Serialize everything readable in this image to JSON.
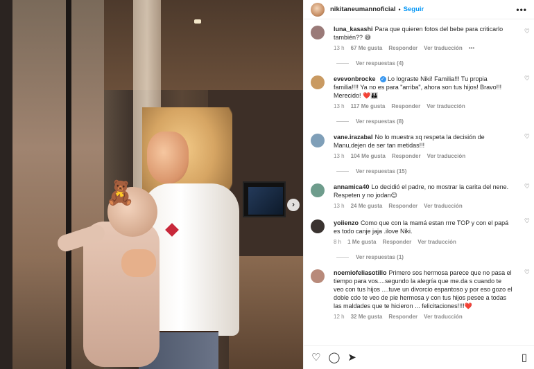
{
  "post": {
    "username": "nikitaneumannoficial",
    "separator": "•",
    "follow_label": "Seguir",
    "more_label": "•••"
  },
  "photo": {
    "sticker": "🧸",
    "next_label": "›"
  },
  "comments": [
    {
      "username": "luna_kasashi",
      "text": "Para que quieren fotos del bebe para criticarlo también?? 😅",
      "time": "13 h",
      "likes": "67 Me gusta",
      "reply": "Responder",
      "translate": "Ver traducción",
      "more": "•••",
      "replies": "Ver respuestas (4)",
      "avatar_color": "#9a7a78"
    },
    {
      "username": "evevonbrocke",
      "verified": "✓",
      "text": "Lo lograste Niki! Familia!!! Tu propia familia!!!! Ya no es para \"arriba\", ahora son tus hijos! Bravo!!! Merecido! ❤️👪",
      "time": "13 h",
      "likes": "117 Me gusta",
      "reply": "Responder",
      "translate": "Ver traducción",
      "replies": "Ver respuestas (8)",
      "avatar_color": "#c99a62"
    },
    {
      "username": "vane.irazabal",
      "text": "No lo muestra xq respeta la decisión de Manu,dejen de ser tan metidas!!!",
      "time": "13 h",
      "likes": "104 Me gusta",
      "reply": "Responder",
      "translate": "Ver traducción",
      "replies": "Ver respuestas (15)",
      "avatar_color": "#7f9fb8"
    },
    {
      "username": "annamica40",
      "text": "Lo decidió el padre, no mostrar la carita del nene. Respeten y no jodan😊",
      "time": "13 h",
      "likes": "24 Me gusta",
      "reply": "Responder",
      "translate": "Ver traducción",
      "avatar_color": "#6e9c8c"
    },
    {
      "username": "yoiienzo",
      "text": "Como que con la mamá estan rrre TOP y con el papá es todo canje jaja .ilove Niki.",
      "time": "8 h",
      "likes": "1 Me gusta",
      "reply": "Responder",
      "translate": "Ver traducción",
      "replies": "Ver respuestas (1)",
      "avatar_color": "#3a3330"
    },
    {
      "username": "noemiofeliasotillo",
      "text": "Primero sos hermosa parece que no pasa el tiempo para vos....segundo la alegría que me.da s cuando te veo con tus hijos ....tuve un divorcio espantoso y por eso gozo el doble cdo te veo de pie hermosa y con tus hijos pesee a todas las maldades que te hicieron ... felicitaciones!!!!❤️",
      "time": "12 h",
      "likes": "32 Me gusta",
      "reply": "Responder",
      "translate": "Ver traducción",
      "avatar_color": "#b88a7a"
    }
  ],
  "icons": {
    "like": "♡",
    "comment": "◯",
    "share": "➤",
    "save": "▯",
    "comment_like": "♡"
  }
}
